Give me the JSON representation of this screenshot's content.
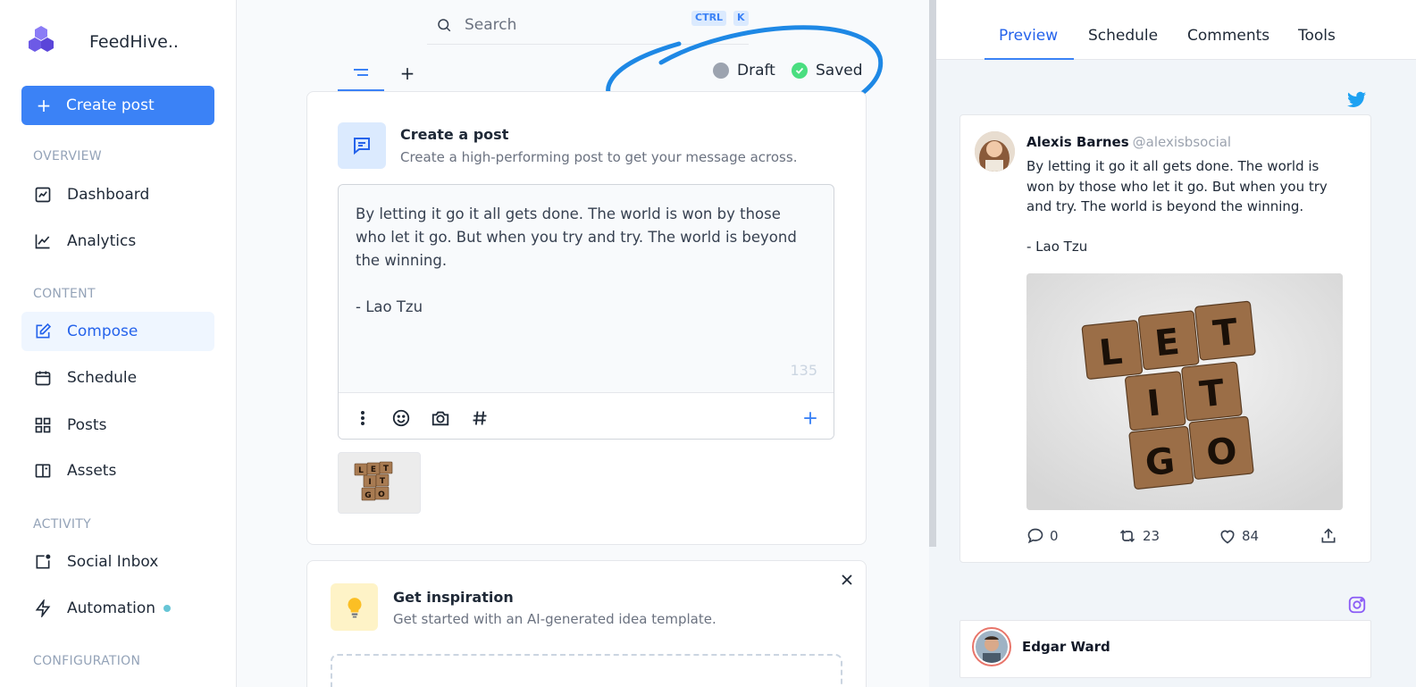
{
  "sidebar": {
    "brand_name": "FeedHive..",
    "create_label": "Create post",
    "sections": [
      {
        "label": "OVERVIEW"
      },
      {
        "label": "CONTENT"
      },
      {
        "label": "ACTIVITY"
      },
      {
        "label": "CONFIGURATION"
      }
    ],
    "items": [
      {
        "label": "Dashboard",
        "icon": "chart-square-icon"
      },
      {
        "label": "Analytics",
        "icon": "line-chart-icon"
      },
      {
        "label": "Compose",
        "icon": "edit-icon",
        "active": true
      },
      {
        "label": "Schedule",
        "icon": "calendar-icon"
      },
      {
        "label": "Posts",
        "icon": "grid-icon"
      },
      {
        "label": "Assets",
        "icon": "book-icon"
      },
      {
        "label": "Social Inbox",
        "icon": "inbox-icon"
      },
      {
        "label": "Automation",
        "icon": "lightning-icon"
      }
    ]
  },
  "search": {
    "placeholder": "Search",
    "shortcut_ctrl": "CTRL",
    "shortcut_key": "K"
  },
  "status": {
    "draft_label": "Draft",
    "saved_label": "Saved"
  },
  "composer": {
    "title": "Create a post",
    "subtitle": "Create a high-performing post to get your message across.",
    "text": "By letting it go it all gets done. The world is won by those who let it go. But when you try and try. The world is beyond the winning.\n\n- Lao Tzu",
    "char_count": "135"
  },
  "inspiration": {
    "title": "Get inspiration",
    "subtitle": "Get started with an AI-generated idea template."
  },
  "right_tabs": [
    {
      "label": "Preview",
      "active": true
    },
    {
      "label": "Schedule"
    },
    {
      "label": "Comments"
    },
    {
      "label": "Tools"
    }
  ],
  "tweet": {
    "name": "Alexis Barnes",
    "handle": "@alexisbsocial",
    "text": "By letting it go it all gets done. The world is won by those who let it go. But when you try and try. The world is beyond the winning.\n\n- Lao Tzu",
    "replies": "0",
    "retweets": "23",
    "likes": "84"
  },
  "instagram": {
    "name": "Edgar Ward"
  },
  "colors": {
    "accent": "#3b82f6",
    "twitter": "#1da1f2",
    "instagram": "#8b5cf6",
    "saved": "#4ade80",
    "draft": "#9ca3af",
    "annotation": "#1e88e5"
  }
}
